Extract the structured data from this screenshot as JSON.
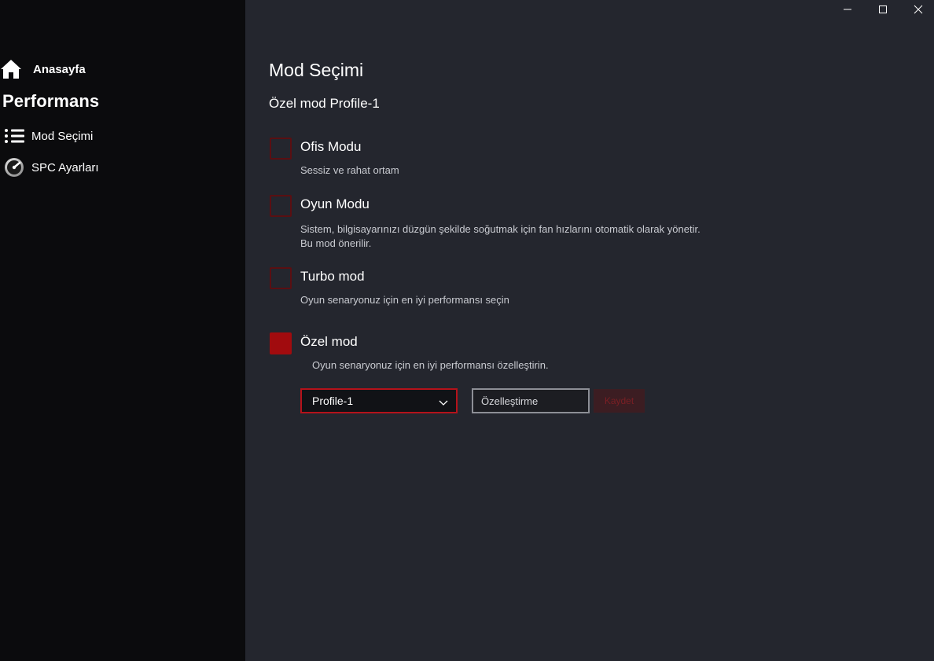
{
  "sidebar": {
    "home_label": "Anasayfa",
    "section_title": "Performans",
    "items": [
      {
        "label": "Mod Seçimi",
        "icon": "list-icon"
      },
      {
        "label": "SPC Ayarları",
        "icon": "gauge-icon"
      }
    ]
  },
  "window_controls": {
    "minimize_icon": "minimize-icon",
    "maximize_icon": "maximize-icon",
    "close_icon": "close-icon"
  },
  "main": {
    "title": "Mod Seçimi",
    "subtitle": "Özel mod Profile-1",
    "modes": [
      {
        "title": "Ofis Modu",
        "description": "Sessiz ve rahat ortam",
        "checked": false
      },
      {
        "title": "Oyun Modu",
        "description_line1": "Sistem, bilgisayarınızı düzgün şekilde soğutmak için fan hızlarını otomatik olarak yönetir.",
        "description_line2": "Bu mod önerilir.",
        "checked": false
      },
      {
        "title": "Turbo mod",
        "description": "Oyun senaryonuz için en iyi performansı seçin",
        "checked": false
      },
      {
        "title": "Özel mod",
        "description": "Oyun senaryonuz için en iyi performansı özelleştirin.",
        "checked": true
      }
    ],
    "profile_select": {
      "selected": "Profile-1"
    },
    "custom_input": {
      "placeholder": "Özelleştirme",
      "value": ""
    },
    "save_button": {
      "label": "Kaydet"
    }
  },
  "colors": {
    "sidebar_bg": "#0b0b0d",
    "content_bg": "#24262e",
    "accent": "#a10b0e",
    "unchecked_border": "#5a0f12"
  }
}
